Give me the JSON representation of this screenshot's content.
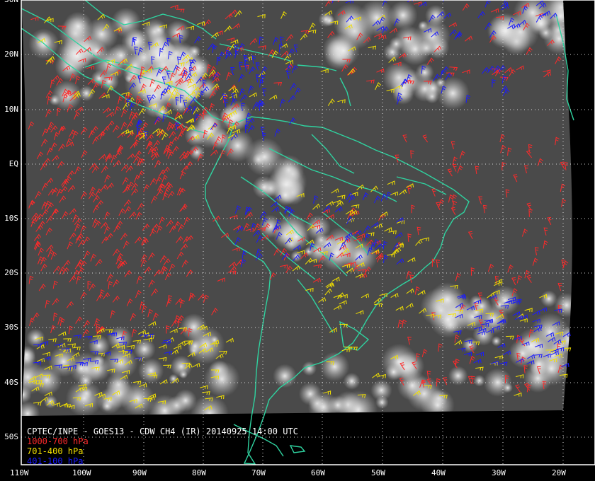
{
  "title": "CPTEC/INPE - GOES13 - CDW CH4 (IR) 20140925 14:00 UTC",
  "legend": [
    {
      "label": "1000-700 hPa",
      "color": "#ff2a2a"
    },
    {
      "label": "701-400 hPa",
      "color": "#f2e000"
    },
    {
      "label": "401-100 hPa",
      "color": "#1a1aff"
    }
  ],
  "lat_labels": [
    "30N",
    "20N",
    "10N",
    "EQ",
    "10S",
    "20S",
    "30S",
    "40S",
    "50S"
  ],
  "lon_labels": [
    "110W",
    "100W",
    "90W",
    "80W",
    "70W",
    "60W",
    "50W",
    "40W",
    "30W",
    "20W"
  ],
  "colors": {
    "coast": "#2fd3a0",
    "grid": "#d8d8d8",
    "background": "#000000"
  }
}
